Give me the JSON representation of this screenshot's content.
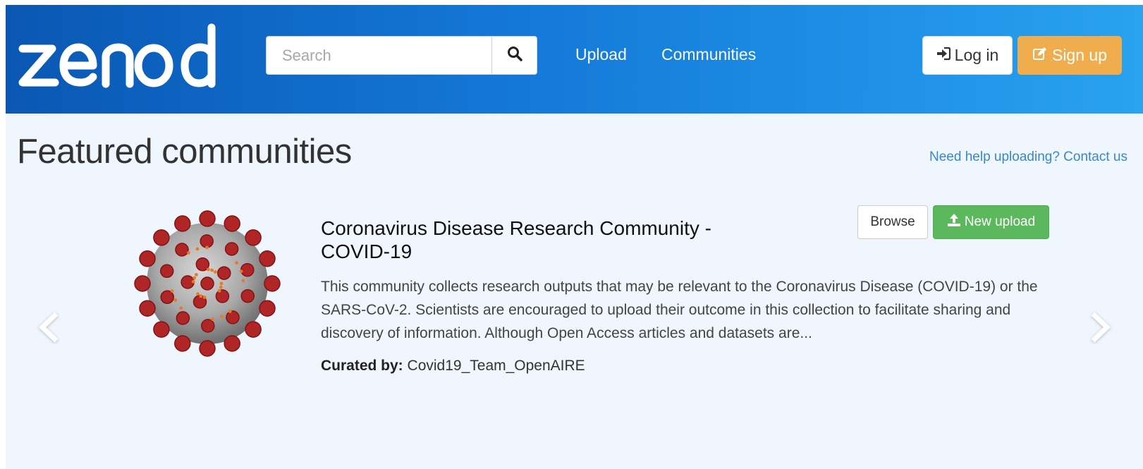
{
  "header": {
    "logo_text": "zenodo",
    "search": {
      "placeholder": "Search",
      "value": ""
    },
    "nav": {
      "upload": "Upload",
      "communities": "Communities"
    },
    "login_label": "Log in",
    "signup_label": "Sign up"
  },
  "main": {
    "title": "Featured communities",
    "help_link": "Need help uploading? Contact us",
    "community": {
      "title": "Coronavirus Disease Research Community - COVID-19",
      "description": "This community collects research outputs that may be relevant to the Coronavirus Disease (COVID-19) or the SARS-CoV-2. Scientists are encouraged to upload their outcome in this collection to facilitate sharing and discovery of information. Although Open Access articles and datasets are...",
      "curated_label": "Curated by:",
      "curated_by": "Covid19_Team_OpenAIRE",
      "browse_label": "Browse",
      "new_upload_label": "New upload"
    }
  },
  "icons": {
    "search": "search-icon",
    "login": "sign-in-icon",
    "signup": "edit-icon",
    "upload": "upload-icon",
    "prev": "chevron-left-icon",
    "next": "chevron-right-icon"
  },
  "colors": {
    "header_start": "#0a57b3",
    "header_end": "#2aa2ef",
    "signup": "#f0ad4e",
    "new_upload": "#5cb85c",
    "link": "#3a87c7",
    "background": "#eff6fd"
  }
}
